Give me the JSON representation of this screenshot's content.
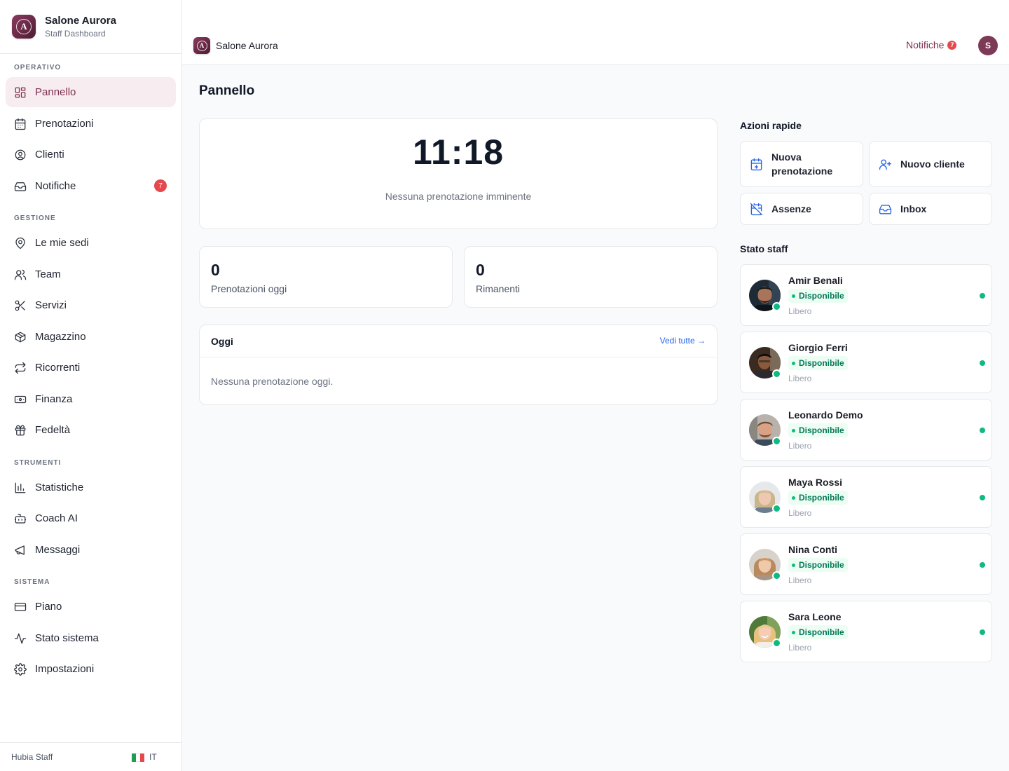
{
  "brand": {
    "name": "Salone Aurora",
    "subtitle": "Staff Dashboard",
    "logo_letter": "A"
  },
  "sidebar": {
    "sections": [
      "OPERATIVO",
      "GESTIONE",
      "STRUMENTI",
      "SISTEMA"
    ],
    "items": [
      {
        "label": "Pannello",
        "icon": "grid-icon",
        "active": true
      },
      {
        "label": "Prenotazioni",
        "icon": "calendar-icon"
      },
      {
        "label": "Clienti",
        "icon": "user-circle-icon"
      },
      {
        "label": "Notifiche",
        "icon": "inbox-icon",
        "badge": "7"
      },
      {
        "label": "Le mie sedi",
        "icon": "map-pin-icon"
      },
      {
        "label": "Team",
        "icon": "users-icon"
      },
      {
        "label": "Servizi",
        "icon": "scissors-icon"
      },
      {
        "label": "Magazzino",
        "icon": "package-icon"
      },
      {
        "label": "Ricorrenti",
        "icon": "repeat-icon"
      },
      {
        "label": "Finanza",
        "icon": "banknote-icon"
      },
      {
        "label": "Fedeltà",
        "icon": "gift-icon"
      },
      {
        "label": "Statistiche",
        "icon": "bar-chart-icon"
      },
      {
        "label": "Coach AI",
        "icon": "bot-icon"
      },
      {
        "label": "Messaggi",
        "icon": "megaphone-icon"
      },
      {
        "label": "Piano",
        "icon": "credit-card-icon"
      },
      {
        "label": "Stato sistema",
        "icon": "activity-icon"
      },
      {
        "label": "Impostazioni",
        "icon": "settings-icon"
      }
    ],
    "footer": {
      "label": "Hubia Staff",
      "lang": "IT"
    }
  },
  "topbar": {
    "brand": "Salone Aurora",
    "notifications_label": "Notifiche",
    "notifications_count": "7",
    "avatar_initial": "S"
  },
  "main": {
    "title": "Pannello",
    "clock": "11:18",
    "clock_note": "Nessuna prenotazione imminente",
    "stats": [
      {
        "value": "0",
        "label": "Prenotazioni oggi"
      },
      {
        "value": "0",
        "label": "Rimanenti"
      }
    ],
    "today": {
      "title": "Oggi",
      "link": "Vedi tutte →",
      "empty": "Nessuna prenotazione oggi."
    }
  },
  "quick_actions": {
    "title": "Azioni rapide",
    "items": [
      {
        "label": "Nuova prenotazione",
        "icon": "calendar-plus-icon"
      },
      {
        "label": "Nuovo cliente",
        "icon": "user-plus-icon"
      },
      {
        "label": "Assenze",
        "icon": "calendar-off-icon"
      },
      {
        "label": "Inbox",
        "icon": "inbox-icon"
      }
    ]
  },
  "staff": {
    "title": "Stato staff",
    "status_label": "Disponibile",
    "members": [
      {
        "name": "Amir Benali",
        "status": "Disponibile",
        "note": "Libero"
      },
      {
        "name": "Giorgio Ferri",
        "status": "Disponibile",
        "note": "Libero"
      },
      {
        "name": "Leonardo Demo",
        "status": "Disponibile",
        "note": "Libero"
      },
      {
        "name": "Maya Rossi",
        "status": "Disponibile",
        "note": "Libero"
      },
      {
        "name": "Nina Conti",
        "status": "Disponibile",
        "note": "Libero"
      },
      {
        "name": "Sara Leone",
        "status": "Disponibile",
        "note": "Libero"
      }
    ]
  },
  "colors": {
    "brand": "#7d2f4f",
    "accent": "#2563eb",
    "success": "#10b981",
    "danger": "#e5484d"
  }
}
